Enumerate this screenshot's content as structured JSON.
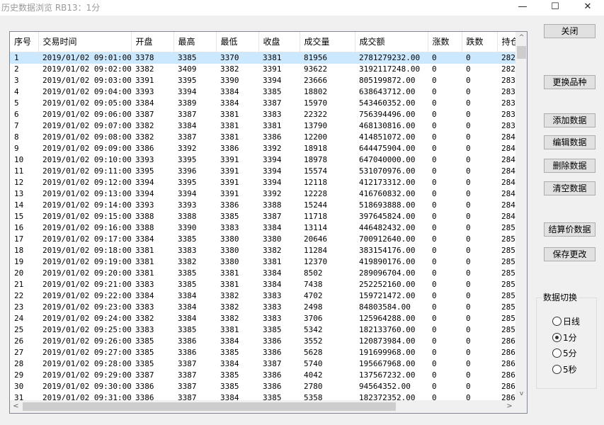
{
  "window": {
    "title": "历史数据浏览 RB13：1分",
    "minimize_glyph": "—",
    "maximize_glyph": "☐",
    "close_glyph": "✕"
  },
  "table": {
    "columns": [
      "序号",
      "交易时间",
      "开盘",
      "最高",
      "最低",
      "收盘",
      "成交量",
      "成交额",
      "涨数",
      "跌数",
      "持仓"
    ],
    "rows": [
      [
        "1",
        "2019/01/02 09:01:00",
        "3378",
        "3385",
        "3370",
        "3381",
        "81956",
        "2781279232.00",
        "0",
        "0",
        "282"
      ],
      [
        "2",
        "2019/01/02 09:02:00",
        "3382",
        "3409",
        "3382",
        "3391",
        "93622",
        "3192117248.00",
        "0",
        "0",
        "282"
      ],
      [
        "3",
        "2019/01/02 09:03:00",
        "3391",
        "3395",
        "3390",
        "3394",
        "23666",
        "805199872.00",
        "0",
        "0",
        "283"
      ],
      [
        "4",
        "2019/01/02 09:04:00",
        "3393",
        "3394",
        "3384",
        "3385",
        "18802",
        "638643712.00",
        "0",
        "0",
        "283"
      ],
      [
        "5",
        "2019/01/02 09:05:00",
        "3384",
        "3389",
        "3384",
        "3387",
        "15970",
        "543460352.00",
        "0",
        "0",
        "283"
      ],
      [
        "6",
        "2019/01/02 09:06:00",
        "3387",
        "3387",
        "3381",
        "3383",
        "22322",
        "756394496.00",
        "0",
        "0",
        "283"
      ],
      [
        "7",
        "2019/01/02 09:07:00",
        "3382",
        "3384",
        "3381",
        "3381",
        "13790",
        "468130816.00",
        "0",
        "0",
        "283"
      ],
      [
        "8",
        "2019/01/02 09:08:00",
        "3382",
        "3387",
        "3381",
        "3386",
        "12200",
        "414851072.00",
        "0",
        "0",
        "284"
      ],
      [
        "9",
        "2019/01/02 09:09:00",
        "3386",
        "3392",
        "3386",
        "3392",
        "18918",
        "644475904.00",
        "0",
        "0",
        "284"
      ],
      [
        "10",
        "2019/01/02 09:10:00",
        "3393",
        "3395",
        "3391",
        "3394",
        "18978",
        "647040000.00",
        "0",
        "0",
        "284"
      ],
      [
        "11",
        "2019/01/02 09:11:00",
        "3395",
        "3396",
        "3391",
        "3394",
        "15574",
        "531070976.00",
        "0",
        "0",
        "284"
      ],
      [
        "12",
        "2019/01/02 09:12:00",
        "3394",
        "3395",
        "3391",
        "3394",
        "12118",
        "412173312.00",
        "0",
        "0",
        "284"
      ],
      [
        "13",
        "2019/01/02 09:13:00",
        "3394",
        "3394",
        "3391",
        "3392",
        "12228",
        "416760832.00",
        "0",
        "0",
        "284"
      ],
      [
        "14",
        "2019/01/02 09:14:00",
        "3393",
        "3393",
        "3386",
        "3388",
        "15244",
        "518693888.00",
        "0",
        "0",
        "284"
      ],
      [
        "15",
        "2019/01/02 09:15:00",
        "3388",
        "3388",
        "3385",
        "3387",
        "11718",
        "397645824.00",
        "0",
        "0",
        "284"
      ],
      [
        "16",
        "2019/01/02 09:16:00",
        "3388",
        "3390",
        "3383",
        "3384",
        "13114",
        "446482432.00",
        "0",
        "0",
        "285"
      ],
      [
        "17",
        "2019/01/02 09:17:00",
        "3384",
        "3385",
        "3380",
        "3380",
        "20646",
        "700912640.00",
        "0",
        "0",
        "285"
      ],
      [
        "18",
        "2019/01/02 09:18:00",
        "3381",
        "3383",
        "3380",
        "3382",
        "11284",
        "383154176.00",
        "0",
        "0",
        "285"
      ],
      [
        "19",
        "2019/01/02 09:19:00",
        "3381",
        "3382",
        "3380",
        "3381",
        "12370",
        "419890176.00",
        "0",
        "0",
        "285"
      ],
      [
        "20",
        "2019/01/02 09:20:00",
        "3381",
        "3385",
        "3381",
        "3384",
        "8502",
        "289096704.00",
        "0",
        "0",
        "285"
      ],
      [
        "21",
        "2019/01/02 09:21:00",
        "3383",
        "3385",
        "3381",
        "3384",
        "7438",
        "252252160.00",
        "0",
        "0",
        "285"
      ],
      [
        "22",
        "2019/01/02 09:22:00",
        "3384",
        "3384",
        "3382",
        "3383",
        "4702",
        "159721472.00",
        "0",
        "0",
        "285"
      ],
      [
        "23",
        "2019/01/02 09:23:00",
        "3383",
        "3384",
        "3382",
        "3383",
        "2498",
        "84803584.00",
        "0",
        "0",
        "285"
      ],
      [
        "24",
        "2019/01/02 09:24:00",
        "3382",
        "3384",
        "3382",
        "3383",
        "3706",
        "125964288.00",
        "0",
        "0",
        "285"
      ],
      [
        "25",
        "2019/01/02 09:25:00",
        "3383",
        "3385",
        "3381",
        "3385",
        "5342",
        "182133760.00",
        "0",
        "0",
        "285"
      ],
      [
        "26",
        "2019/01/02 09:26:00",
        "3385",
        "3386",
        "3384",
        "3386",
        "3552",
        "120873984.00",
        "0",
        "0",
        "286"
      ],
      [
        "27",
        "2019/01/02 09:27:00",
        "3385",
        "3386",
        "3385",
        "3386",
        "5628",
        "191699968.00",
        "0",
        "0",
        "286"
      ],
      [
        "28",
        "2019/01/02 09:28:00",
        "3385",
        "3387",
        "3384",
        "3387",
        "5740",
        "195667968.00",
        "0",
        "0",
        "286"
      ],
      [
        "29",
        "2019/01/02 09:29:00",
        "3387",
        "3387",
        "3385",
        "3386",
        "4042",
        "137567232.00",
        "0",
        "0",
        "286"
      ],
      [
        "30",
        "2019/01/02 09:30:00",
        "3386",
        "3387",
        "3385",
        "3386",
        "2780",
        "94564352.00",
        "0",
        "0",
        "286"
      ],
      [
        "31",
        "2019/01/02 09:31:00",
        "3386",
        "3387",
        "3384",
        "3385",
        "5358",
        "182372352.00",
        "0",
        "0",
        "286"
      ]
    ],
    "selected_index": 0
  },
  "scroll": {
    "up_glyph": "^",
    "down_glyph": "v",
    "left_glyph": "<",
    "right_glyph": ">"
  },
  "buttons": {
    "close": "关闭",
    "change_product": "更换品种",
    "add": "添加数据",
    "edit": "编辑数据",
    "delete": "删除数据",
    "clear": "清空数据",
    "settlement": "结算价数据",
    "save": "保存更改"
  },
  "data_switch": {
    "title": "数据切换",
    "options": [
      "日线",
      "1分",
      "5分",
      "5秒"
    ],
    "selected_index": 1
  }
}
